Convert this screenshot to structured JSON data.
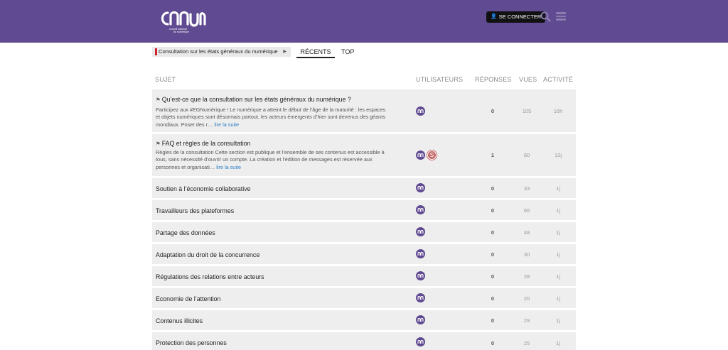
{
  "header": {
    "logo_lines": [
      "conseil national",
      "du numérique"
    ],
    "login_label": "SE CONNECTER",
    "icons": [
      "user-icon",
      "search-icon",
      "hamburger-icon"
    ]
  },
  "nav": {
    "category": "Consultation sur les états généraux du numérique",
    "tabs": [
      "RÉCENTS",
      "TOP"
    ]
  },
  "table": {
    "headers": {
      "topic": "SUJET",
      "users": "UTILISATEURS",
      "replies": "RÉPONSES",
      "views": "VUES",
      "activity": "ACTIVITÉ"
    },
    "rows": [
      {
        "pinned": true,
        "title": "Qu’est-ce que la consultation sur les états généraux du numérique ?",
        "excerpt": "Participez aux #EGNumérique ! Le numérique a atteint le début de l’âge de la maturité : les espaces et objets numériques sont désormais partout, les acteurs émergents d’hier sont devenus des géants mondiaux. Poser des r…",
        "more": "lire la suite",
        "replies": "0",
        "views": "105",
        "activity": "16h"
      },
      {
        "pinned": true,
        "title": "FAQ et règles de la consultation",
        "excerpt": "Règles de la consultation Cette section est publique et l’ensemble de ses contenus est accessible à tous, sans nécessité d’ouvrir un compte. La création et l’édition de messages est réservée aux personnes et organisati…",
        "more": "lire la suite",
        "second_avatar": "S",
        "replies": "1",
        "views": "60",
        "activity": "12j"
      },
      {
        "title": "Soutien à l’économie collaborative",
        "replies": "0",
        "views": "33",
        "activity": "1j"
      },
      {
        "title": "Travailleurs des plateformes",
        "replies": "0",
        "views": "65",
        "activity": "1j"
      },
      {
        "title": "Partage des données",
        "replies": "0",
        "views": "48",
        "activity": "1j"
      },
      {
        "title": "Adaptation du droit de la concurrence",
        "replies": "0",
        "views": "30",
        "activity": "1j"
      },
      {
        "title": "Régulations des relations entre acteurs",
        "replies": "0",
        "views": "28",
        "activity": "1j"
      },
      {
        "title": "Economie de l’attention",
        "replies": "0",
        "views": "20",
        "activity": "1j"
      },
      {
        "title": "Contenus illicites",
        "replies": "0",
        "views": "29",
        "activity": "1j"
      },
      {
        "title": "Protection des personnes",
        "replies": "0",
        "views": "25",
        "activity": "1j"
      }
    ]
  },
  "colors": {
    "header_bg": "#604a91",
    "row_bg": "#eeeeee",
    "link": "#2a7bc4",
    "category_accent": "#d0212c"
  }
}
